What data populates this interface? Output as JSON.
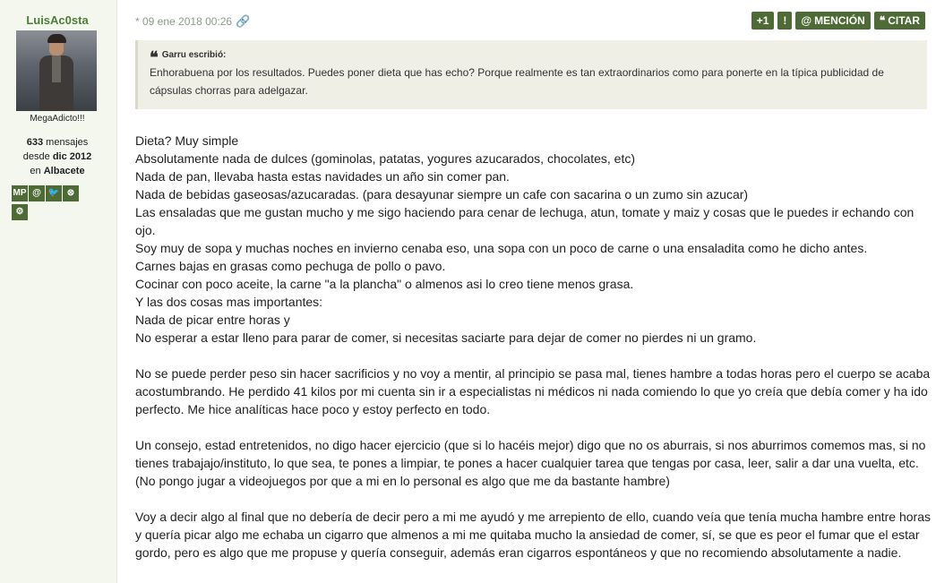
{
  "user": {
    "name": "LuisAc0sta",
    "rank": "MegaAdicto!!!",
    "posts_count": "633",
    "posts_label": "mensajes",
    "since_label": "desde",
    "since": "dic 2012",
    "location_prefix": "en",
    "location": "Albacete",
    "icons": [
      {
        "name": "mp-icon",
        "glyph": "MP"
      },
      {
        "name": "mention-icon",
        "glyph": "@"
      },
      {
        "name": "twitter-icon",
        "glyph": "🐦"
      },
      {
        "name": "xbox-icon",
        "glyph": "⊗"
      },
      {
        "name": "steam-icon",
        "glyph": "⚙"
      }
    ]
  },
  "meta": {
    "timestamp": "* 09 ene 2018 00:26"
  },
  "actions": {
    "plus_one": "+1",
    "report": "!",
    "mention": "MENCIÓN",
    "quote": "CITAR"
  },
  "quote": {
    "author": "Garru escribió:",
    "text": "Enhorabuena por los resultados. Puedes poner dieta que has echo? Porque realmente es tan extraordinarios como para ponerte en la típica publicidad de cápsulas chorras para adelgazar."
  },
  "post": {
    "lines": [
      "Dieta? Muy simple",
      "Absolutamente nada de dulces (gominolas, patatas, yogures azucarados, chocolates, etc)",
      "Nada de pan, llevaba hasta estas navidades un año sin comer pan.",
      "Nada de bebidas gaseosas/azucaradas. (para desayunar siempre un cafe con sacarina o un zumo sin azucar)",
      "Las ensaladas que me gustan mucho y me sigo haciendo para cenar de lechuga, atun, tomate y maiz y cosas que le puedes ir echando con ojo.",
      "Soy muy de sopa y muchas noches en invierno cenaba eso, una sopa con un poco de carne o una ensaladita como he dicho antes.",
      "Carnes bajas en grasas como pechuga de pollo o pavo.",
      "Cocinar con poco aceite, la carne \"a la plancha\" o almenos asi lo creo tiene menos grasa.",
      "Y las dos cosas mas importantes:",
      "Nada de picar entre horas y",
      "No esperar a estar lleno para parar de comer, si necesitas saciarte para dejar de comer no pierdes ni un gramo."
    ],
    "paragraph_2": "No se puede perder peso sin hacer sacrificios y no voy a mentir, al principio se pasa mal, tienes hambre a todas horas pero el cuerpo se acaba acostumbrando. He perdido 41 kilos por mi cuenta sin ir a especialistas ni médicos ni nada comiendo lo que yo creía que debía comer y ha ido perfecto. Me hice analíticas hace poco y estoy perfecto en todo.",
    "paragraph_3": "Un consejo, estad entretenidos, no digo hacer ejercicio (que si lo hacéis mejor) digo que no os aburrais, si nos aburrimos comemos mas, si no tienes trabajajo/instituto, lo que sea, te pones a limpiar, te pones a hacer cualquier tarea que tengas por casa, leer, salir a dar una vuelta, etc. (No pongo jugar a videojuegos por que a mi en lo personal es algo que me da bastante hambre)",
    "paragraph_4": "Voy a decir algo al final que no debería de decir pero a mi me ayudó y me arrepiento de ello, cuando veía que tenía mucha hambre entre horas y quería picar algo me echaba un cigarro que almenos a mi me quitaba mucho la ansiedad de comer, sí, se que es peor el fumar que el estar gordo, pero es algo que me propuse y quería conseguir, además eran cigarros espontáneos y que no recomiendo absolutamente a nadie."
  }
}
